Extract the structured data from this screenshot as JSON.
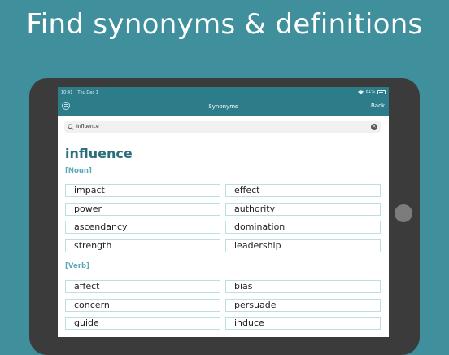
{
  "headline": "Find synonyms & definitions",
  "status": {
    "time": "10:41",
    "date": "Thu Dec 1",
    "battery": "81%"
  },
  "nav": {
    "title": "Synonyms",
    "back": "Back"
  },
  "search": {
    "value": "Influence",
    "placeholder": ""
  },
  "entry": {
    "word": "influence",
    "groups": [
      {
        "pos": "[Noun]",
        "synonyms": [
          "impact",
          "effect",
          "power",
          "authority",
          "ascendancy",
          "domination",
          "strength",
          "leadership"
        ]
      },
      {
        "pos": "[Verb]",
        "synonyms": [
          "affect",
          "bias",
          "concern",
          "persuade",
          "guide",
          "induce"
        ]
      }
    ]
  },
  "colors": {
    "accent": "#2c7c89",
    "background": "#3f8f9c",
    "chip_border": "#bcdfe4"
  },
  "icons": {
    "menu": "menu-circle-icon",
    "search": "search-icon",
    "clear": "clear-icon",
    "wifi": "wifi-icon",
    "battery": "battery-icon"
  }
}
